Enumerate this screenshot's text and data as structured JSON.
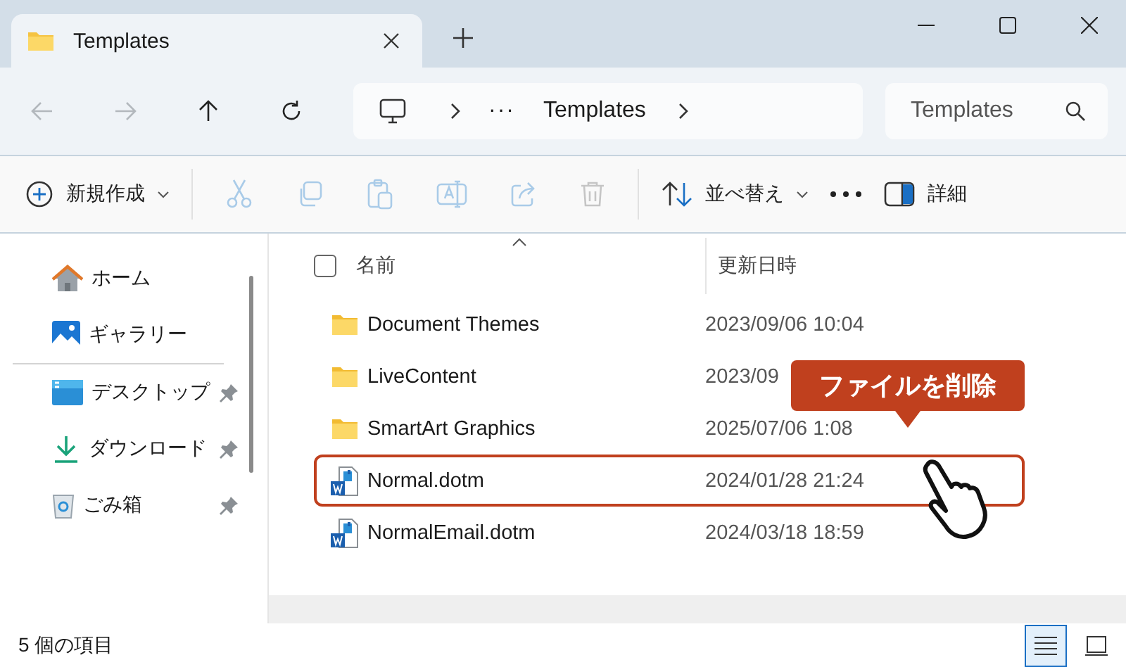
{
  "tab": {
    "title": "Templates"
  },
  "nav": [
    {
      "kind": "back",
      "disabled": true
    },
    {
      "kind": "forward",
      "disabled": true
    },
    {
      "kind": "up",
      "disabled": false
    },
    {
      "kind": "refresh",
      "disabled": false
    }
  ],
  "address": {
    "ellipsis": "···",
    "segments": [
      "Templates"
    ]
  },
  "search": {
    "placeholder": "Templates"
  },
  "toolbar": [
    {
      "kind": "new",
      "label": "新規作成",
      "disabled": false
    },
    {
      "kind": "cut",
      "disabled": true
    },
    {
      "kind": "copy",
      "disabled": true
    },
    {
      "kind": "paste",
      "disabled": true
    },
    {
      "kind": "rename",
      "disabled": true
    },
    {
      "kind": "share",
      "disabled": true
    },
    {
      "kind": "delete",
      "disabled": true
    },
    {
      "kind": "sort",
      "label": "並べ替え",
      "disabled": false
    },
    {
      "kind": "more",
      "disabled": false
    },
    {
      "kind": "details",
      "label": "詳細",
      "disabled": false
    }
  ],
  "sidebar": {
    "groups": [
      [
        {
          "kind": "home",
          "label": "ホーム",
          "pinned": false
        },
        {
          "kind": "gallery",
          "label": "ギャラリー",
          "pinned": false
        }
      ],
      [
        {
          "kind": "desktop",
          "label": "デスクトップ",
          "pinned": true
        },
        {
          "kind": "download",
          "label": "ダウンロード",
          "pinned": true
        },
        {
          "kind": "trash",
          "label": "ごみ箱",
          "pinned": true
        }
      ]
    ]
  },
  "table": {
    "select_all": {
      "checked": false
    },
    "columns": [
      "名前",
      "更新日時"
    ],
    "rows": [
      {
        "kind": "folder",
        "name": "Document Themes",
        "modified": "2023/09/06 10:04",
        "highlighted": false
      },
      {
        "kind": "folder",
        "name": "LiveContent",
        "modified": "2023/09",
        "highlighted": false
      },
      {
        "kind": "folder",
        "name": "SmartArt Graphics",
        "modified": "2025/07/06 1:08",
        "highlighted": false
      },
      {
        "kind": "word",
        "name": "Normal.dotm",
        "modified": "2024/01/28 21:24",
        "highlighted": true
      },
      {
        "kind": "word",
        "name": "NormalEmail.dotm",
        "modified": "2024/03/18 18:59",
        "highlighted": false
      }
    ]
  },
  "callout": {
    "text": "ファイルを削除"
  },
  "status_bar": {
    "count": "5 個の項目",
    "views": [
      {
        "kind": "details",
        "selected": true
      },
      {
        "kind": "tiles",
        "selected": false
      }
    ]
  }
}
